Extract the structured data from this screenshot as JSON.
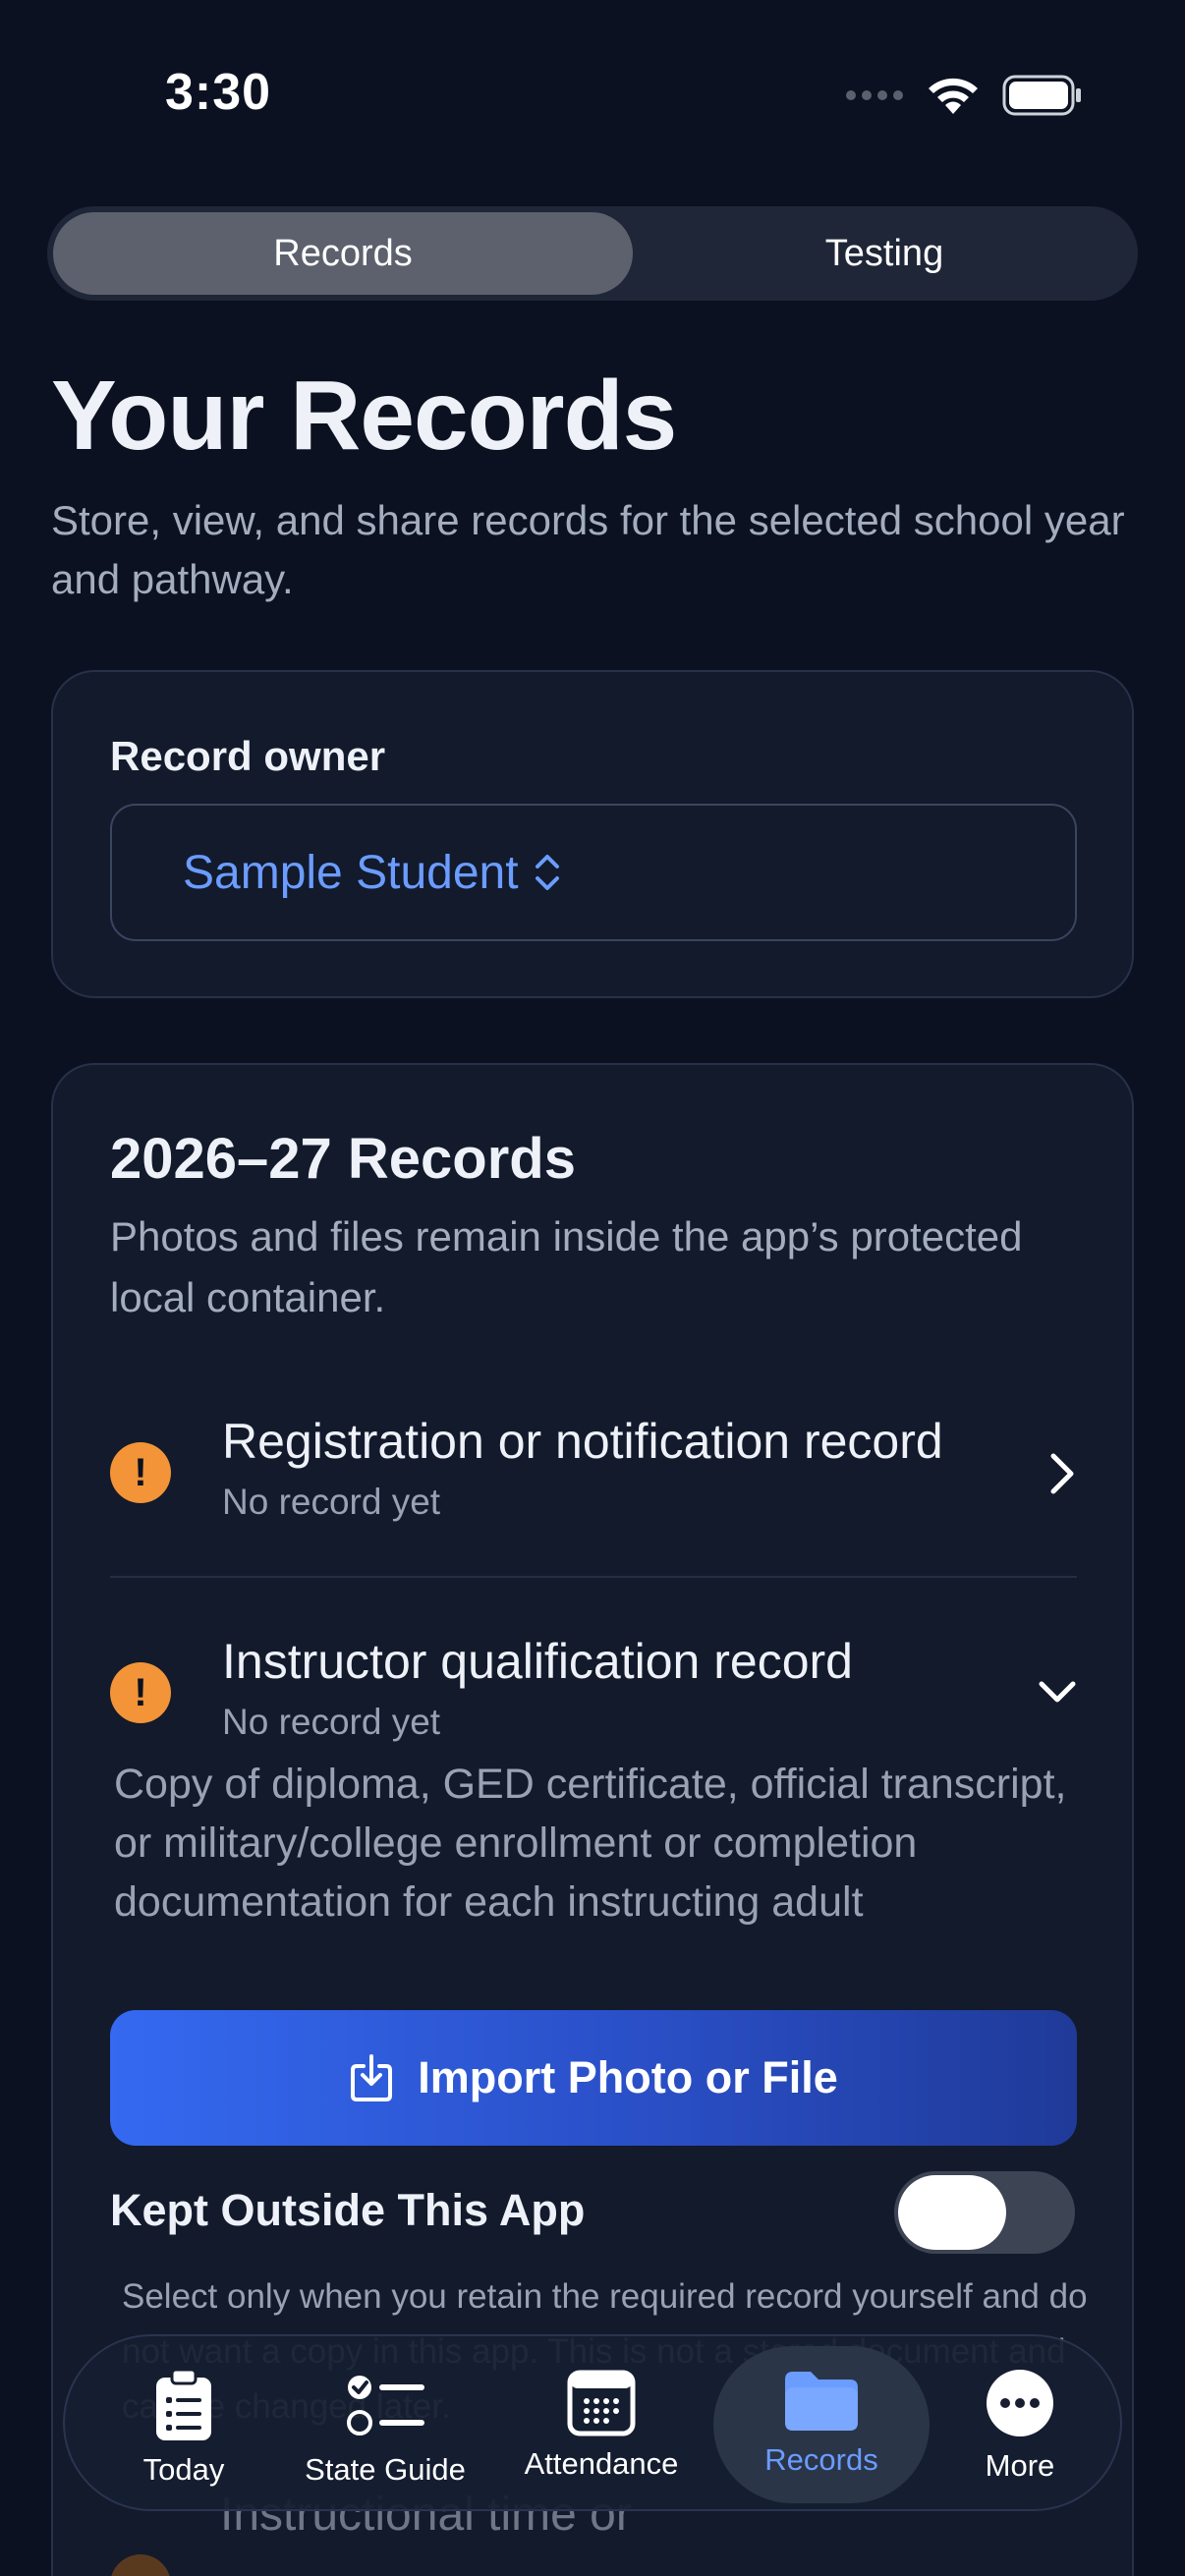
{
  "status_bar": {
    "time": "3:30"
  },
  "segments": [
    {
      "label": "Records",
      "active": true
    },
    {
      "label": "Testing",
      "active": false
    }
  ],
  "page": {
    "title": "Your Records",
    "subtitle": "Store, view, and share records for the selected school year and pathway."
  },
  "owner": {
    "label": "Record owner",
    "selected": "Sample Student"
  },
  "records": {
    "title": "2026–27 Records",
    "description": "Photos and files remain inside the app’s protected local container.",
    "items": [
      {
        "title": "Registration or notification record",
        "status": "No record yet",
        "expanded": false
      },
      {
        "title": "Instructor qualification record",
        "status": "No record yet",
        "expanded": true,
        "description": "Copy of diploma, GED certificate, official transcript, or military/college enrollment or completion documentation for each instructing adult"
      },
      {
        "title": "Instructional time or"
      }
    ],
    "import_label": "Import Photo or File",
    "kept_outside": {
      "label": "Kept Outside This App",
      "enabled": false,
      "description": "Select only when you retain the required record yourself and do not want a copy in this app. This is not a stored document and can be changed later."
    }
  },
  "tabs": [
    {
      "label": "Today",
      "icon": "clipboard-icon",
      "active": false
    },
    {
      "label": "State Guide",
      "icon": "checklist-icon",
      "active": false
    },
    {
      "label": "Attendance",
      "icon": "calendar-icon",
      "active": false
    },
    {
      "label": "Records",
      "icon": "folder-icon",
      "active": true
    },
    {
      "label": "More",
      "icon": "more-icon",
      "active": false
    }
  ],
  "colors": {
    "background": "#0b1120",
    "card": "#121a2c",
    "accent": "#6b9cff",
    "warning": "#f29437",
    "button_gradient_start": "#3469f0",
    "button_gradient_end": "#1f3a98"
  }
}
